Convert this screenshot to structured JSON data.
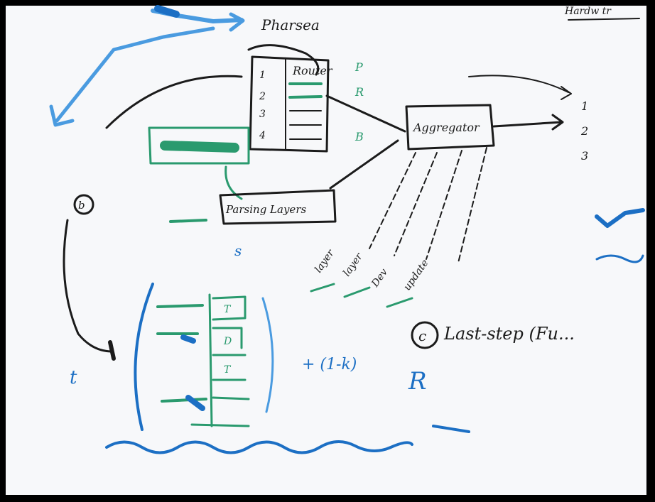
{
  "image": {
    "labels": {
      "top_node": "Pharsea",
      "table_header": "Router",
      "center_node": "Aggregator",
      "bottom_node": "Parsing Layers",
      "circle_b": "b",
      "circle_c": "c",
      "equation_right": "Last-step (Fu...",
      "equation_mid": "+ (1-k)",
      "equation_left": "t"
    },
    "colors": {
      "board": "#f7f8fa",
      "frame": "#000000",
      "black_ink": "#1b1b1b",
      "blue_ink": "#1c6fc4",
      "green_ink": "#2a9a6e"
    }
  }
}
